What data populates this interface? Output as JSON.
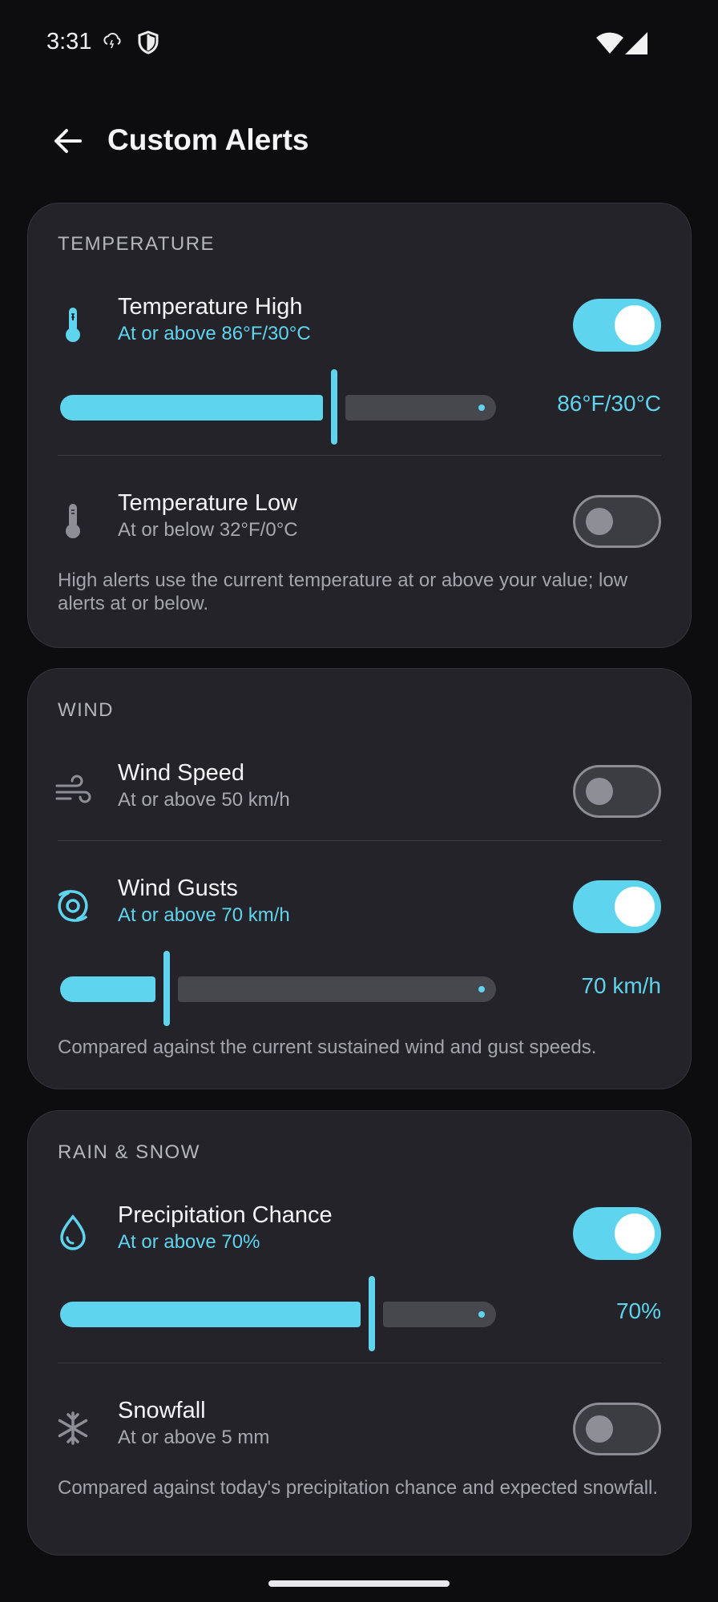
{
  "status": {
    "time": "3:31"
  },
  "header": {
    "title": "Custom Alerts"
  },
  "temperature": {
    "label": "TEMPERATURE",
    "high": {
      "title": "Temperature High",
      "subtitle": "At or above 86°F/30°C",
      "enabled": true,
      "value_label": "86°F/30°C",
      "slider_fraction": 0.59
    },
    "low": {
      "title": "Temperature Low",
      "subtitle": "At or below 32°F/0°C",
      "enabled": false
    },
    "help": "High alerts use the current temperature at or above your value; low alerts at or below."
  },
  "wind": {
    "label": "WIND",
    "speed": {
      "title": "Wind Speed",
      "subtitle": "At or above 50 km/h",
      "enabled": false
    },
    "gusts": {
      "title": "Wind Gusts",
      "subtitle": "At or above 70 km/h",
      "enabled": true,
      "value_label": "70 km/h",
      "slider_fraction": 0.23
    },
    "help": "Compared against the current sustained wind and gust speeds."
  },
  "precip": {
    "label": "RAIN & SNOW",
    "chance": {
      "title": "Precipitation Chance",
      "subtitle": "At or above 70%",
      "enabled": true,
      "value_label": "70%",
      "slider_fraction": 0.67
    },
    "snow": {
      "title": "Snowfall",
      "subtitle": "At or above 5 mm",
      "enabled": false
    },
    "help": "Compared against today's precipitation chance and expected snowfall."
  },
  "colors": {
    "accent": "#5fd4ef",
    "background": "#0d0d10",
    "card": "#232329"
  },
  "icons": [
    "weather-alert-icon",
    "shield-icon",
    "wifi-icon",
    "signal-icon",
    "back-arrow-icon",
    "thermometer-icon",
    "wind-icon",
    "cyclone-icon",
    "water-drop-icon",
    "snowflake-icon"
  ]
}
